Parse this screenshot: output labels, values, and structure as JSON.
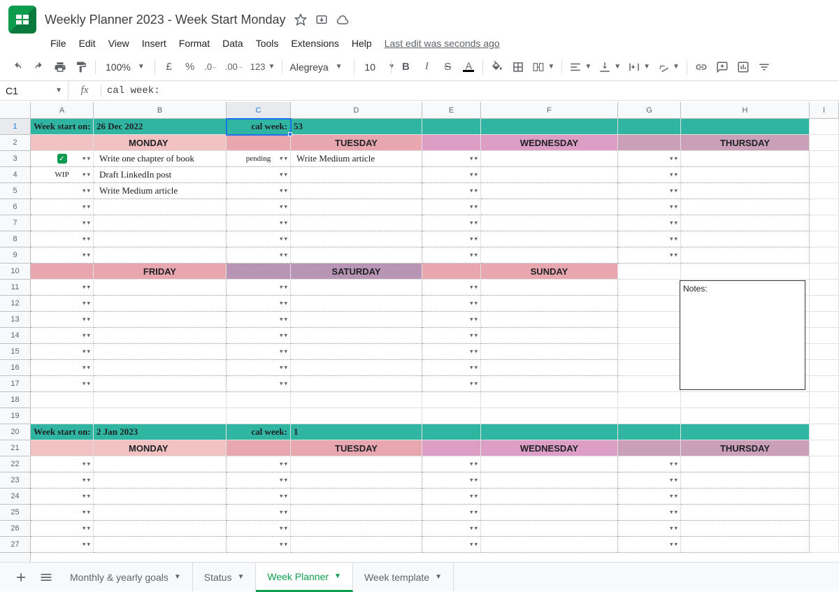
{
  "doc": {
    "title": "Weekly Planner 2023 - Week Start Monday",
    "last_edit": "Last edit was seconds ago"
  },
  "menu": {
    "file": "File",
    "edit": "Edit",
    "view": "View",
    "insert": "Insert",
    "format": "Format",
    "data": "Data",
    "tools": "Tools",
    "extensions": "Extensions",
    "help": "Help"
  },
  "toolbar": {
    "zoom": "100%",
    "currency": "£",
    "percent": "%",
    "format_num": "123",
    "font": "Alegreya",
    "font_size": "10",
    "bold": "B",
    "italic": "I",
    "strike": "S",
    "textcolor": "A"
  },
  "formula": {
    "cell_ref": "C1",
    "fx": "fx",
    "value": "cal week:"
  },
  "columns": [
    "A",
    "B",
    "C",
    "D",
    "E",
    "F",
    "G",
    "H",
    "I"
  ],
  "col_widths": [
    "cA",
    "cB",
    "cC",
    "cD",
    "cE",
    "cF",
    "cG",
    "cH",
    "cI"
  ],
  "rows_count": 27,
  "week1": {
    "start_label": "Week start on:",
    "start_date": "26 Dec 2022",
    "cal_label": "cal week:",
    "cal_num": "53",
    "days": {
      "mon": "MONDAY",
      "tue": "TUESDAY",
      "wed": "WEDNESDAY",
      "thu": "THURSDAY",
      "fri": "FRIDAY",
      "sat": "SATURDAY",
      "sun": "SUNDAY"
    },
    "tasks": {
      "mon": [
        {
          "status": "done",
          "text": "Write one chapter of book"
        },
        {
          "status": "WIP",
          "text": "Draft LinkedIn post"
        },
        {
          "status": "",
          "text": "Write Medium article"
        }
      ],
      "tue": [
        {
          "status": "pending",
          "text": "Write Medium article"
        }
      ]
    },
    "notes_label": "Notes:"
  },
  "week2": {
    "start_label": "Week start on:",
    "start_date": "2 Jan 2023",
    "cal_label": "cal week:",
    "cal_num": "1",
    "days": {
      "mon": "MONDAY",
      "tue": "TUESDAY",
      "wed": "WEDNESDAY",
      "thu": "THURSDAY"
    }
  },
  "sheets": {
    "tab1": "Monthly & yearly goals",
    "tab2": "Status",
    "tab3": "Week Planner",
    "tab4": "Week template"
  }
}
